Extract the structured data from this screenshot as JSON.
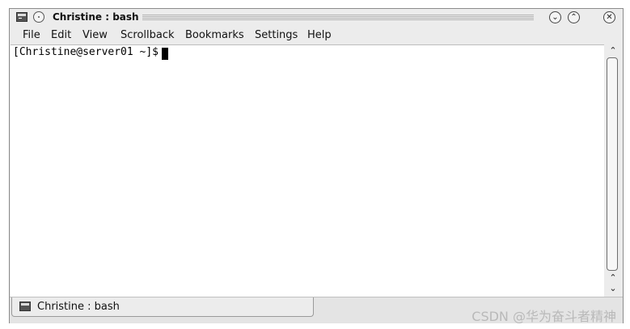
{
  "window": {
    "title": "Christine : bash"
  },
  "menubar": {
    "items": [
      "File",
      "Edit",
      "View",
      "Scrollback",
      "Bookmarks",
      "Settings",
      "Help"
    ]
  },
  "terminal": {
    "prompt": "[Christine@server01 ~]$"
  },
  "tabs": [
    {
      "label": "Christine : bash"
    }
  ],
  "watermark": "CSDN @华为奋斗者精神",
  "icons": {
    "app": "terminal-icon",
    "sticky": "sticky-dot-icon",
    "minimize": "chevron-down-circle-icon",
    "maximize": "chevron-up-circle-icon",
    "close": "close-x-circle-icon"
  }
}
